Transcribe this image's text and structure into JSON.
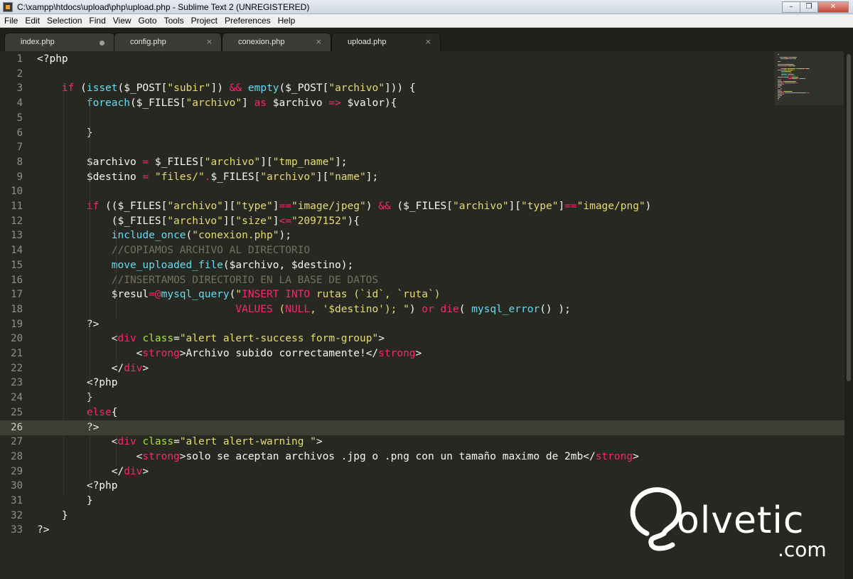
{
  "window": {
    "title": "C:\\xampp\\htdocs\\upload\\php\\upload.php - Sublime Text 2 (UNREGISTERED)",
    "minimize": "–",
    "restore": "❐",
    "close": "✕"
  },
  "menu": [
    "File",
    "Edit",
    "Selection",
    "Find",
    "View",
    "Goto",
    "Tools",
    "Project",
    "Preferences",
    "Help"
  ],
  "tabs": [
    {
      "label": "index.php",
      "dirty": true
    },
    {
      "label": "config.php",
      "close": "×"
    },
    {
      "label": "conexion.php",
      "close": "×"
    },
    {
      "label": "upload.php",
      "close": "×",
      "active": true
    }
  ],
  "editor": {
    "current_line": 26,
    "line_numbers": [
      "1",
      "2",
      "3",
      "4",
      "5",
      "6",
      "7",
      "8",
      "9",
      "10",
      "11",
      "12",
      "13",
      "14",
      "15",
      "16",
      "17",
      "18",
      "19",
      "20",
      "21",
      "22",
      "23",
      "24",
      "25",
      "26",
      "27",
      "28",
      "29",
      "30",
      "31",
      "32",
      "33"
    ],
    "lines": [
      [
        [
          "p",
          "<?php"
        ]
      ],
      [],
      [
        [
          "p",
          "    "
        ],
        [
          "k",
          "if"
        ],
        [
          "p",
          " ("
        ],
        [
          "f",
          "isset"
        ],
        [
          "p",
          "($_POST["
        ],
        [
          "s",
          "\"subir\""
        ],
        [
          "p",
          "]) "
        ],
        [
          "k",
          "&&"
        ],
        [
          "p",
          " "
        ],
        [
          "f",
          "empty"
        ],
        [
          "p",
          "($_POST["
        ],
        [
          "s",
          "\"archivo\""
        ],
        [
          "p",
          "])) {"
        ]
      ],
      [
        [
          "p",
          "        "
        ],
        [
          "f",
          "foreach"
        ],
        [
          "p",
          "($_FILES["
        ],
        [
          "s",
          "\"archivo\""
        ],
        [
          "p",
          "] "
        ],
        [
          "k",
          "as"
        ],
        [
          "p",
          " $archivo "
        ],
        [
          "k",
          "=>"
        ],
        [
          "p",
          " $valor){"
        ]
      ],
      [],
      [
        [
          "p",
          "        }"
        ]
      ],
      [],
      [
        [
          "p",
          "        $archivo "
        ],
        [
          "k",
          "="
        ],
        [
          "p",
          " $_FILES["
        ],
        [
          "s",
          "\"archivo\""
        ],
        [
          "p",
          "]["
        ],
        [
          "s",
          "\"tmp_name\""
        ],
        [
          "p",
          "];"
        ]
      ],
      [
        [
          "p",
          "        $destino "
        ],
        [
          "k",
          "="
        ],
        [
          "p",
          " "
        ],
        [
          "s",
          "\"files/\""
        ],
        [
          "k",
          "."
        ],
        [
          "p",
          "$_FILES["
        ],
        [
          "s",
          "\"archivo\""
        ],
        [
          "p",
          "]["
        ],
        [
          "s",
          "\"name\""
        ],
        [
          "p",
          "];"
        ]
      ],
      [],
      [
        [
          "p",
          "        "
        ],
        [
          "k",
          "if"
        ],
        [
          "p",
          " (($_FILES["
        ],
        [
          "s",
          "\"archivo\""
        ],
        [
          "p",
          "]["
        ],
        [
          "s",
          "\"type\""
        ],
        [
          "p",
          "]"
        ],
        [
          "k",
          "=="
        ],
        [
          "s",
          "\"image/jpeg\""
        ],
        [
          "p",
          ") "
        ],
        [
          "k",
          "&&"
        ],
        [
          "p",
          " ($_FILES["
        ],
        [
          "s",
          "\"archivo\""
        ],
        [
          "p",
          "]["
        ],
        [
          "s",
          "\"type\""
        ],
        [
          "p",
          "]"
        ],
        [
          "k",
          "=="
        ],
        [
          "s",
          "\"image/png\""
        ],
        [
          "p",
          ")"
        ]
      ],
      [
        [
          "p",
          "            ($_FILES["
        ],
        [
          "s",
          "\"archivo\""
        ],
        [
          "p",
          "]["
        ],
        [
          "s",
          "\"size\""
        ],
        [
          "p",
          "]"
        ],
        [
          "k",
          "<="
        ],
        [
          "s",
          "\"2097152\""
        ],
        [
          "p",
          "){"
        ]
      ],
      [
        [
          "p",
          "            "
        ],
        [
          "f",
          "include_once"
        ],
        [
          "p",
          "("
        ],
        [
          "s",
          "\"conexion.php\""
        ],
        [
          "p",
          ");"
        ]
      ],
      [
        [
          "p",
          "            "
        ],
        [
          "c",
          "//COPIAMOS ARCHIVO AL DIRECTORIO"
        ]
      ],
      [
        [
          "p",
          "            "
        ],
        [
          "f",
          "move_uploaded_file"
        ],
        [
          "p",
          "($archivo, $destino);"
        ]
      ],
      [
        [
          "p",
          "            "
        ],
        [
          "c",
          "//INSERTAMOS DIRECTORIO EN LA BASE DE DATOS"
        ]
      ],
      [
        [
          "p",
          "            $resul"
        ],
        [
          "k",
          "=@"
        ],
        [
          "f",
          "mysql_query"
        ],
        [
          "p",
          "("
        ],
        [
          "s",
          "\""
        ],
        [
          "k",
          "INSERT INTO"
        ],
        [
          "s",
          " rutas (`id`, `ruta`)"
        ]
      ],
      [
        [
          "s",
          "                                "
        ],
        [
          "k",
          "VALUES"
        ],
        [
          "s",
          " ("
        ],
        [
          "k",
          "NULL"
        ],
        [
          "s",
          ", '$destino'); \""
        ],
        [
          "p",
          ") "
        ],
        [
          "k",
          "or"
        ],
        [
          "p",
          " "
        ],
        [
          "k",
          "die"
        ],
        [
          "p",
          "( "
        ],
        [
          "f",
          "mysql_error"
        ],
        [
          "p",
          "() );"
        ]
      ],
      [
        [
          "p",
          "        ?>"
        ]
      ],
      [
        [
          "p",
          "            <"
        ],
        [
          "k",
          "div"
        ],
        [
          "p",
          " "
        ],
        [
          "a",
          "class"
        ],
        [
          "p",
          "="
        ],
        [
          "s",
          "\"alert alert-success form-group\""
        ],
        [
          "p",
          ">"
        ]
      ],
      [
        [
          "p",
          "                <"
        ],
        [
          "k",
          "strong"
        ],
        [
          "p",
          ">Archivo subido correctamente!</"
        ],
        [
          "k",
          "strong"
        ],
        [
          "p",
          ">"
        ]
      ],
      [
        [
          "p",
          "            </"
        ],
        [
          "k",
          "div"
        ],
        [
          "p",
          ">"
        ]
      ],
      [
        [
          "p",
          "        <?php"
        ]
      ],
      [
        [
          "p",
          "        }"
        ]
      ],
      [
        [
          "p",
          "        "
        ],
        [
          "k",
          "else"
        ],
        [
          "p",
          "{"
        ]
      ],
      [
        [
          "p",
          "        ?>"
        ]
      ],
      [
        [
          "p",
          "            <"
        ],
        [
          "k",
          "div"
        ],
        [
          "p",
          " "
        ],
        [
          "a",
          "class"
        ],
        [
          "p",
          "="
        ],
        [
          "s",
          "\"alert alert-warning \""
        ],
        [
          "p",
          ">"
        ]
      ],
      [
        [
          "p",
          "                <"
        ],
        [
          "k",
          "strong"
        ],
        [
          "p",
          ">solo se aceptan archivos .jpg o .png con un tamaño maximo de 2mb</"
        ],
        [
          "k",
          "strong"
        ],
        [
          "p",
          ">"
        ]
      ],
      [
        [
          "p",
          "            </"
        ],
        [
          "k",
          "div"
        ],
        [
          "p",
          ">"
        ]
      ],
      [
        [
          "p",
          "        <?php"
        ]
      ],
      [
        [
          "p",
          "        }"
        ]
      ],
      [
        [
          "p",
          "    }"
        ]
      ],
      [
        [
          "p",
          "?>"
        ]
      ]
    ]
  },
  "watermark": {
    "word": "olvetic",
    "domain": ".com"
  },
  "colors": {
    "background": "#272822",
    "keyword": "#f92672",
    "function": "#66d9ef",
    "string": "#e6db74",
    "comment": "#75715e",
    "attribute": "#a6e22e"
  }
}
